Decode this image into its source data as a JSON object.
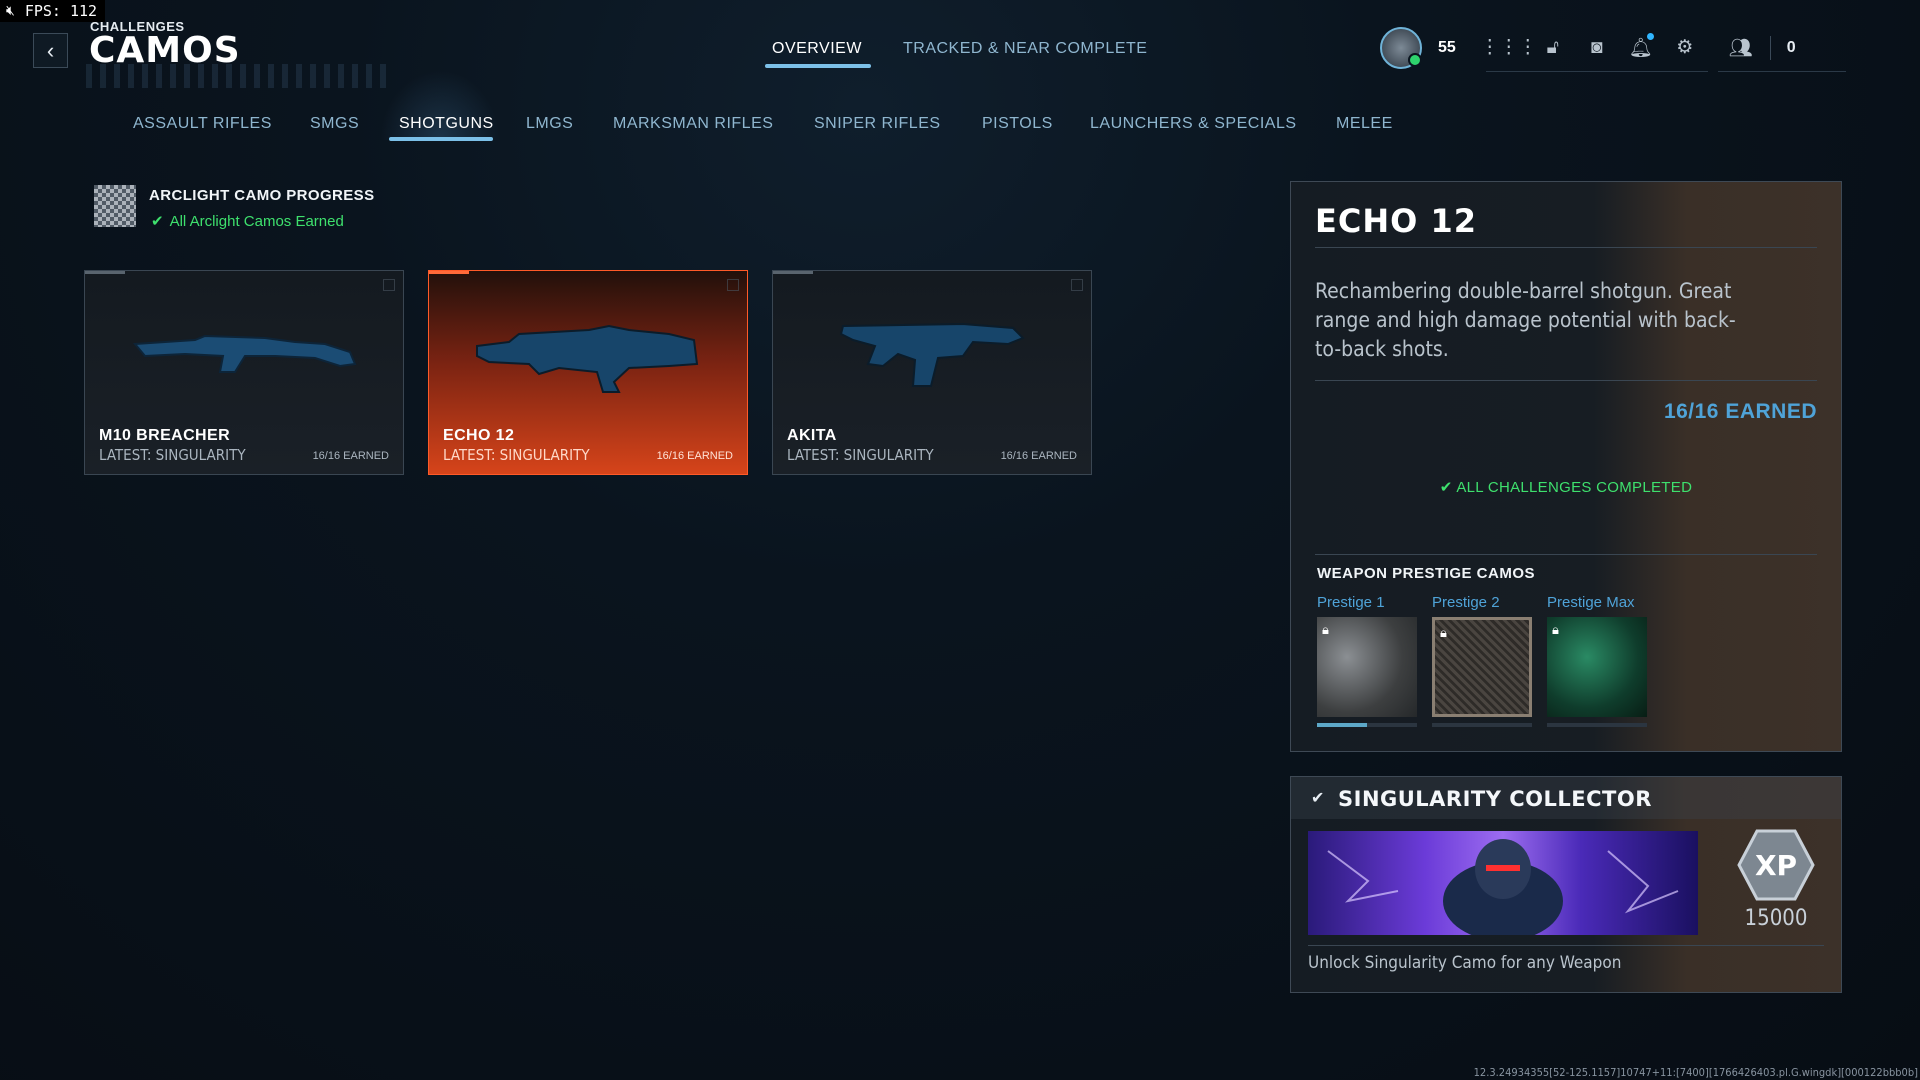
{
  "overlay": {
    "fps": "FPS: 112"
  },
  "header": {
    "breadcrumb": "CHALLENGES",
    "title": "CAMOS",
    "tabs": [
      {
        "label": "OVERVIEW",
        "active": true
      },
      {
        "label": "TRACKED & NEAR COMPLETE",
        "active": false
      }
    ],
    "player_level": "55",
    "friends_online": "0"
  },
  "categories": [
    {
      "label": "ASSAULT RIFLES"
    },
    {
      "label": "SMGS"
    },
    {
      "label": "SHOTGUNS",
      "active": true
    },
    {
      "label": "LMGS"
    },
    {
      "label": "MARKSMAN RIFLES"
    },
    {
      "label": "SNIPER RIFLES"
    },
    {
      "label": "PISTOLS"
    },
    {
      "label": "LAUNCHERS & SPECIALS"
    },
    {
      "label": "MELEE"
    }
  ],
  "progress": {
    "title": "ARCLIGHT CAMO PROGRESS",
    "status": "All Arclight Camos Earned"
  },
  "weapons": [
    {
      "name": "M10 BREACHER",
      "latest": "LATEST: SINGULARITY",
      "earned": "16/16 EARNED",
      "selected": false
    },
    {
      "name": "ECHO 12",
      "latest": "LATEST: SINGULARITY",
      "earned": "16/16 EARNED",
      "selected": true
    },
    {
      "name": "AKITA",
      "latest": "LATEST: SINGULARITY",
      "earned": "16/16 EARNED",
      "selected": false
    }
  ],
  "detail": {
    "name": "ECHO 12",
    "description": "Rechambering double-barrel shotgun. Great range and high damage potential with back-to-back shots.",
    "earned": "16/16 EARNED",
    "status": "ALL CHALLENGES COMPLETED",
    "prestige_title": "WEAPON PRESTIGE CAMOS",
    "prestige": [
      {
        "label": "Prestige 1",
        "progress": 0.5
      },
      {
        "label": "Prestige 2",
        "progress": 0
      },
      {
        "label": "Prestige Max",
        "progress": 0
      }
    ]
  },
  "collector": {
    "title": "SINGULARITY COLLECTOR",
    "xp_badge": "XP",
    "xp": "15000",
    "description": "Unlock Singularity Camo for any Weapon"
  },
  "version": "12.3.24934355[52-125.1157]10747+11:[7400][1766426403.pl.G.wingdk][000122bbb0b]",
  "colors": {
    "accent": "#7cc0e8",
    "selected_card": "#d6441a",
    "success": "#3ee06d",
    "earned": "#4fa3d8"
  }
}
